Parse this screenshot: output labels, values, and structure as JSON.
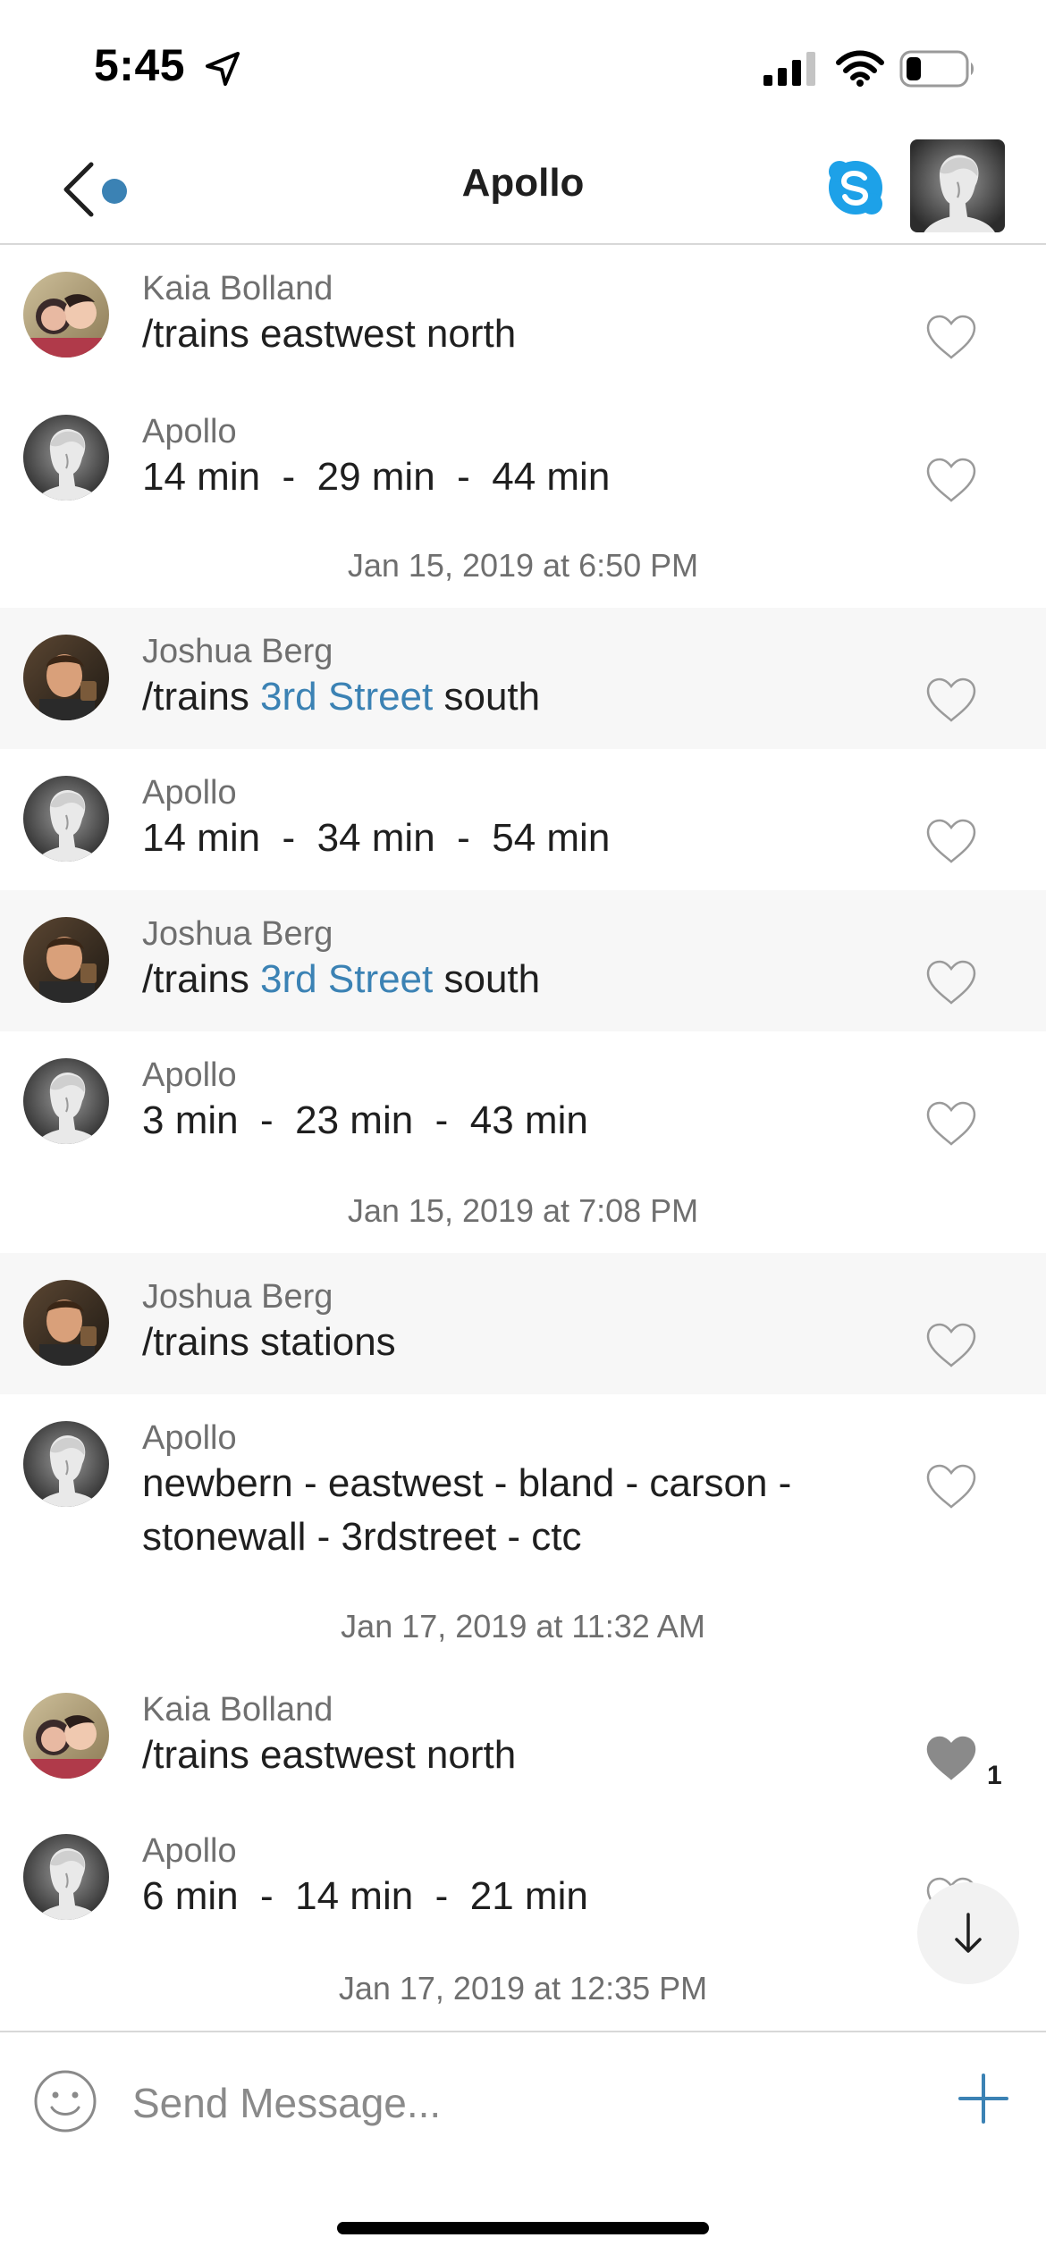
{
  "status_bar": {
    "time": "5:45"
  },
  "header": {
    "title": "Apollo"
  },
  "messages": [
    {
      "sender": "Kaia Bolland",
      "text": "/trains eastwest north",
      "avatar": "kaia"
    },
    {
      "sender": "Apollo",
      "text": "14 min  -  29 min  -  44 min",
      "avatar": "apollo"
    },
    {
      "timestamp": "Jan 15, 2019 at 6:50 PM"
    },
    {
      "sender": "Joshua Berg",
      "text_before": "/trains ",
      "text_link": "3rd Street",
      "text_after": " south",
      "avatar": "joshua",
      "highlighted": true
    },
    {
      "sender": "Apollo",
      "text": "14 min  -  34 min  -  54 min",
      "avatar": "apollo"
    },
    {
      "sender": "Joshua Berg",
      "text_before": "/trains ",
      "text_link": "3rd Street",
      "text_after": " south",
      "avatar": "joshua",
      "highlighted": true
    },
    {
      "sender": "Apollo",
      "text": "3 min  -  23 min  -  43 min",
      "avatar": "apollo"
    },
    {
      "timestamp": "Jan 15, 2019 at 7:08 PM"
    },
    {
      "sender": "Joshua Berg",
      "text": "/trains stations",
      "avatar": "joshua",
      "highlighted": true
    },
    {
      "sender": "Apollo",
      "text_line1": "newbern - eastwest - bland - carson -",
      "text_line2": "stonewall - 3rdstreet - ctc",
      "avatar": "apollo"
    },
    {
      "timestamp": "Jan 17, 2019 at 11:32 AM"
    },
    {
      "sender": "Kaia Bolland",
      "text": "/trains eastwest north",
      "avatar": "kaia",
      "liked": true,
      "likes": "1"
    },
    {
      "sender": "Apollo",
      "text": "6 min  -  14 min  -  21 min",
      "avatar": "apollo"
    },
    {
      "timestamp": "Jan 17, 2019 at 12:35 PM"
    }
  ],
  "composer": {
    "placeholder": "Send Message..."
  },
  "colors": {
    "accent": "#3b82b4",
    "highlight_row": "#f7f7f7",
    "meta_text": "#6f6f6f",
    "skype_blue": "#1da1e8"
  },
  "icons": {
    "back": "chevron-left-icon",
    "skype": "skype-icon",
    "like": "heart-icon",
    "scroll": "arrow-down-icon",
    "emoji": "smiley-icon",
    "add": "plus-icon"
  }
}
